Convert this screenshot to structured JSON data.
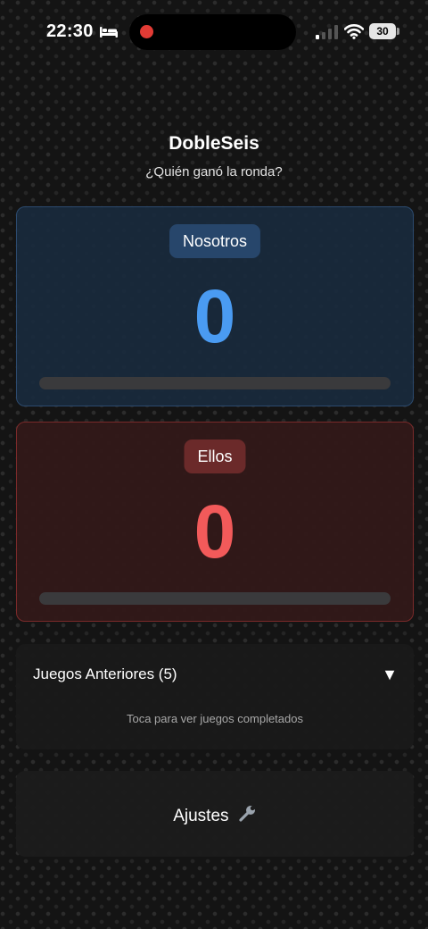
{
  "status_bar": {
    "time": "22:30",
    "battery": "30",
    "icons": [
      "bed-icon",
      "recording-dot-icon",
      "cellular-signal-icon",
      "wifi-icon",
      "battery-icon"
    ]
  },
  "header": {
    "title": "DobleSeis",
    "subtitle": "¿Quién ganó la ronda?"
  },
  "teams": [
    {
      "name": "Nosotros",
      "score": "0",
      "progress": 0,
      "color": "#4a9bf2"
    },
    {
      "name": "Ellos",
      "score": "0",
      "progress": 0,
      "color": "#f25a5a"
    }
  ],
  "history": {
    "title": "Juegos Anteriores (5)",
    "toggle": "▼",
    "hint": "Toca para ver juegos completados"
  },
  "settings": {
    "label": "Ajustes",
    "icon": "wrench-icon"
  }
}
